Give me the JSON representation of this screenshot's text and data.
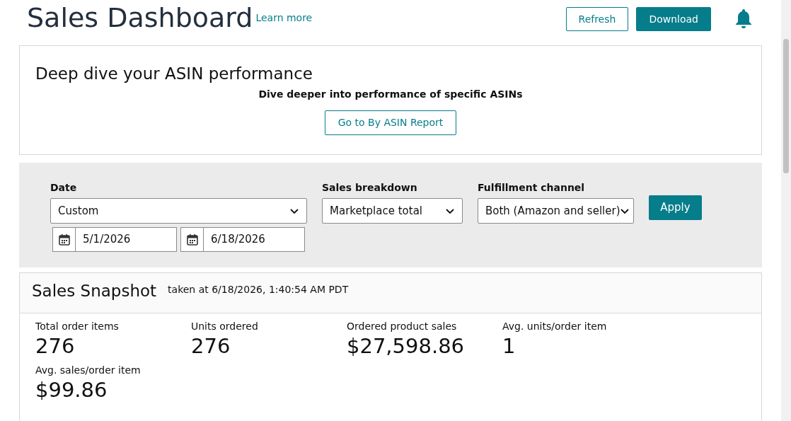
{
  "header": {
    "title": "Sales Dashboard",
    "learn_more": "Learn more",
    "buttons": [
      {
        "label": "Refresh",
        "kind": "secondary"
      },
      {
        "label": "Download",
        "kind": "primary"
      }
    ]
  },
  "asin_card": {
    "title": "Deep dive your ASIN performance",
    "subtitle": "Dive deeper into performance of specific ASINs",
    "button": "Go to By ASIN Report"
  },
  "filters": {
    "date": {
      "label": "Date",
      "value": "Custom",
      "start": "5/1/2026",
      "end": "6/18/2026"
    },
    "selects": [
      {
        "label": "Sales breakdown",
        "value": "Marketplace total"
      },
      {
        "label": "Fulfillment channel",
        "value": "Both (Amazon and seller)"
      }
    ],
    "apply": "Apply"
  },
  "snapshot": {
    "title": "Sales Snapshot",
    "taken_at": "taken at 6/18/2026, 1:40:54 AM PDT",
    "metrics": [
      {
        "label": "Total order items",
        "value": "276"
      },
      {
        "label": "Units ordered",
        "value": "276"
      },
      {
        "label": "Ordered product sales",
        "value": "$27,598.86"
      },
      {
        "label": "Avg. units/order item",
        "value": "1"
      },
      {
        "label": "Avg. sales/order item",
        "value": "$99.86"
      }
    ]
  }
}
